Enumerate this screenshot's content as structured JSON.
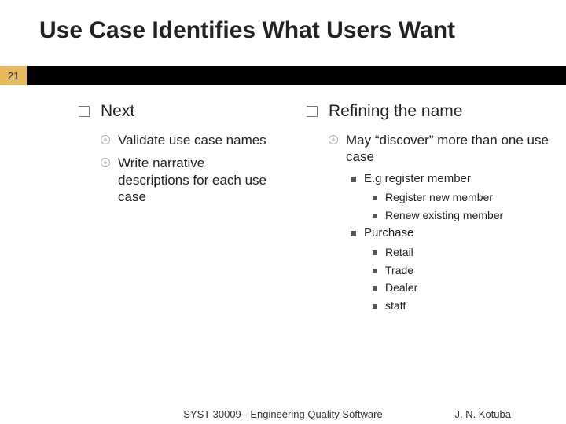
{
  "title": "Use Case Identifies What Users Want",
  "page_number": "21",
  "left": {
    "heading": "Next",
    "items": [
      "Validate use case names",
      "Write narrative descriptions for each use case"
    ]
  },
  "right": {
    "heading": "Refining the name",
    "sub": "May “discover” more than one use case",
    "groups": [
      {
        "label": "E.g register member",
        "items": [
          "Register new member",
          "Renew existing member"
        ]
      },
      {
        "label": "Purchase",
        "items": [
          "Retail",
          "Trade",
          "Dealer",
          "staff"
        ]
      }
    ]
  },
  "footer": {
    "course": "SYST 30009 - Engineering Quality Software",
    "author": "J. N. Kotuba"
  }
}
